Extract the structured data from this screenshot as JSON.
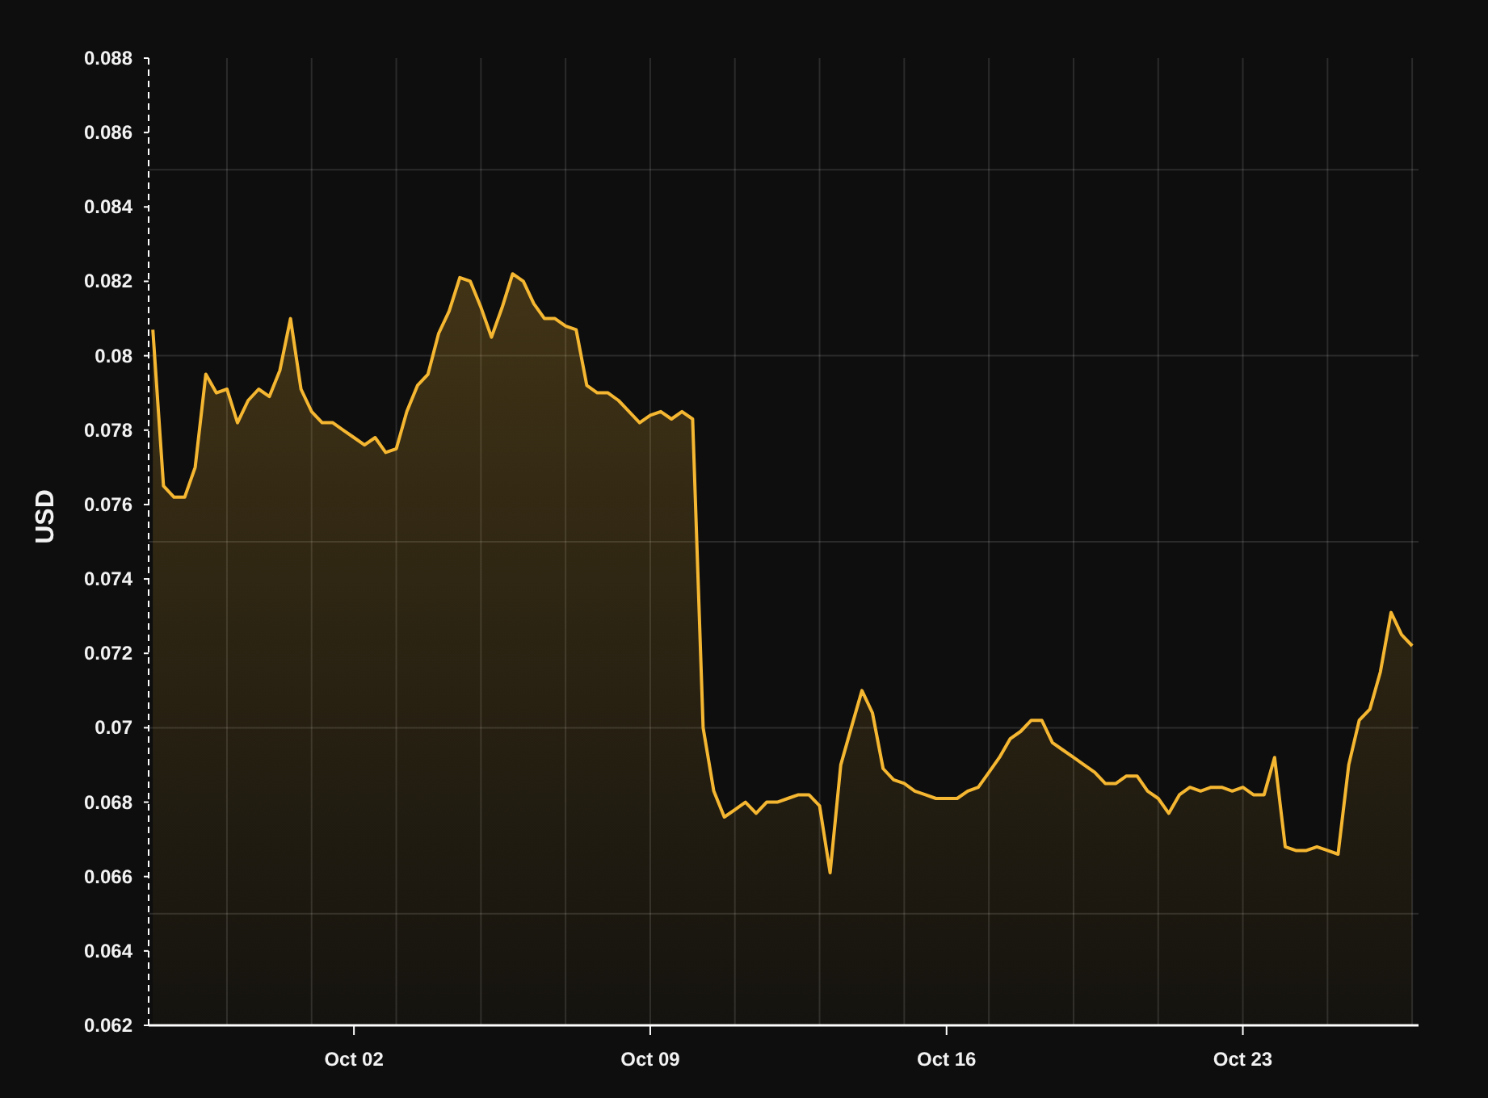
{
  "chart_data": {
    "type": "area",
    "ylabel": "USD",
    "grid": true,
    "ylim": [
      0.062,
      0.088
    ],
    "yticks": [
      0.062,
      0.064,
      0.066,
      0.068,
      0.07,
      0.072,
      0.074,
      0.076,
      0.078,
      0.08,
      0.082,
      0.084,
      0.086,
      0.088
    ],
    "categories": [
      null,
      null,
      null,
      null,
      null,
      null,
      null,
      null,
      null,
      null,
      null,
      null,
      null,
      null,
      null,
      null,
      null,
      null,
      null,
      "Oct 02",
      null,
      null,
      null,
      null,
      null,
      null,
      null,
      null,
      null,
      null,
      null,
      null,
      null,
      null,
      null,
      null,
      null,
      null,
      null,
      null,
      null,
      null,
      null,
      null,
      null,
      null,
      null,
      "Oct 09",
      null,
      null,
      null,
      null,
      null,
      null,
      null,
      null,
      null,
      null,
      null,
      null,
      null,
      null,
      null,
      null,
      null,
      null,
      null,
      null,
      null,
      null,
      null,
      null,
      null,
      null,
      null,
      "Oct 16",
      null,
      null,
      null,
      null,
      null,
      null,
      null,
      null,
      null,
      null,
      null,
      null,
      null,
      null,
      null,
      null,
      null,
      null,
      null,
      null,
      null,
      null,
      null,
      null,
      null,
      null,
      null,
      "Oct 23",
      null,
      null,
      null,
      null,
      null,
      null,
      null,
      null,
      null,
      null,
      null,
      null,
      null,
      null,
      null,
      null
    ],
    "series": [
      {
        "color": "#f5b731",
        "values": [
          0.0807,
          0.0765,
          0.0762,
          0.0762,
          0.077,
          0.0795,
          0.079,
          0.0791,
          0.0782,
          0.0788,
          0.0791,
          0.0789,
          0.0796,
          0.081,
          0.0791,
          0.0785,
          0.0782,
          0.0782,
          0.078,
          0.0778,
          0.0776,
          0.0778,
          0.0774,
          0.0775,
          0.0785,
          0.0792,
          0.0795,
          0.0806,
          0.0812,
          0.0821,
          0.082,
          0.0813,
          0.0805,
          0.0813,
          0.0822,
          0.082,
          0.0814,
          0.081,
          0.081,
          0.0808,
          0.0807,
          0.0792,
          0.079,
          0.079,
          0.0788,
          0.0785,
          0.0782,
          0.0784,
          0.0785,
          0.0783,
          0.0785,
          0.0783,
          0.07,
          0.0683,
          0.0676,
          0.0678,
          0.068,
          0.0677,
          0.068,
          0.068,
          0.0681,
          0.0682,
          0.0682,
          0.0679,
          0.0661,
          0.069,
          0.07,
          0.071,
          0.0704,
          0.0689,
          0.0686,
          0.0685,
          0.0683,
          0.0682,
          0.0681,
          0.0681,
          0.0681,
          0.0683,
          0.0684,
          0.0688,
          0.0692,
          0.0697,
          0.0699,
          0.0702,
          0.0702,
          0.0696,
          0.0694,
          0.0692,
          0.069,
          0.0688,
          0.0685,
          0.0685,
          0.0687,
          0.0687,
          0.0683,
          0.0681,
          0.0677,
          0.0682,
          0.0684,
          0.0683,
          0.0684,
          0.0684,
          0.0683,
          0.0684,
          0.0682,
          0.0682,
          0.0692,
          0.0668,
          0.0667,
          0.0667,
          0.0668,
          0.0667,
          0.0666,
          0.069,
          0.0702,
          0.0705,
          0.0715,
          0.0731,
          0.0725,
          0.0722
        ]
      }
    ]
  }
}
